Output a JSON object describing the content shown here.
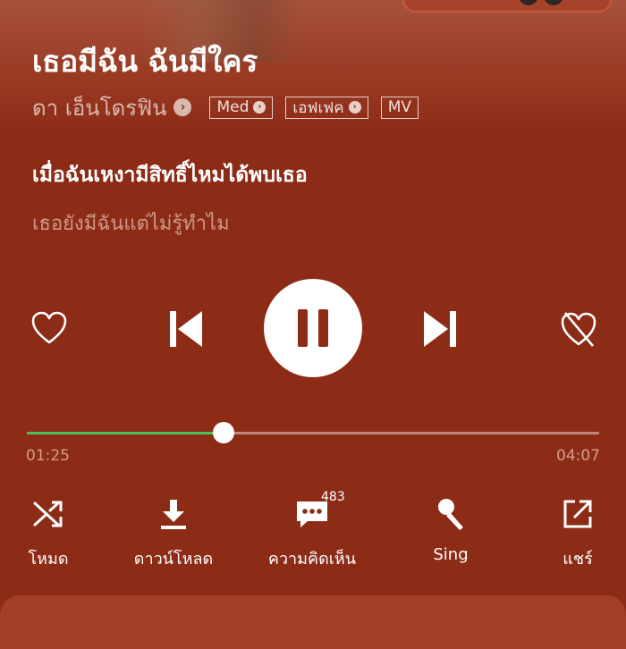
{
  "song": {
    "title": "เธอมีฉัน ฉันมีใคร",
    "artist": "ดา เอ็นโดรฟิน"
  },
  "tags": [
    "Med",
    "เอฟเฟค",
    "MV"
  ],
  "lyrics": {
    "current": "เมื่อฉันเหงามีสิทธิ์ไหมได้พบเธอ",
    "next": "เธอยังมีฉันแต่ไม่รู้ทำไม"
  },
  "player": {
    "elapsed": "01:25",
    "duration": "04:07",
    "progress_fraction": 0.344,
    "state": "playing"
  },
  "actions": {
    "mode": "โหมด",
    "download": "ดาวน์โหลด",
    "comments": "ความคิดเห็น",
    "comment_count": "483",
    "sing": "Sing",
    "share": "แชร์"
  },
  "colors": {
    "background": "#8c2b16",
    "progress": "#4cc35a",
    "panel": "#a13e25"
  }
}
